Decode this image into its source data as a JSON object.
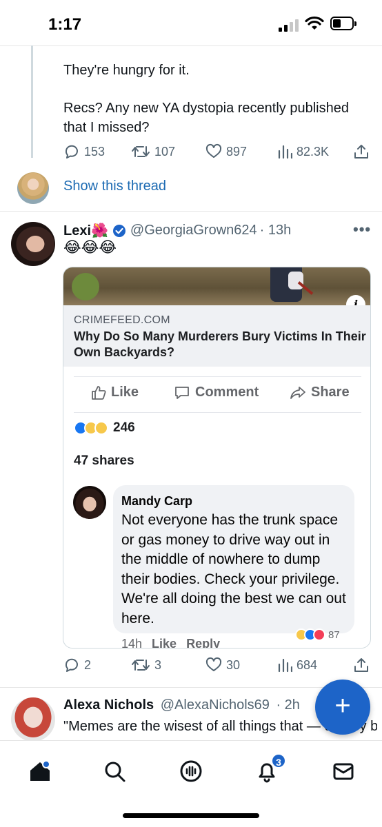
{
  "status_bar": {
    "time": "1:17"
  },
  "thread_tweet": {
    "line1": "They're hungry for it.",
    "line2": "Recs? Any new YA dystopia recently published",
    "line3": "that I missed?",
    "replies": "153",
    "retweets": "107",
    "likes": "897",
    "views": "82.3K",
    "show_thread": "Show this thread"
  },
  "tweet": {
    "name": "Lexi🌺",
    "handle": "@GeorgiaGrown624",
    "time": "· 13h",
    "more": "•••",
    "text": "😂😂😂",
    "replies": "2",
    "retweets": "3",
    "likes": "30",
    "views": "684",
    "embed": {
      "domain": "CRIMEFEED.COM",
      "title": "Why Do So Many Murderers Bury Victims In Their Own Backyards?",
      "info": "i",
      "like_label": "Like",
      "comment_label": "Comment",
      "share_label": "Share",
      "reaction_count": "246",
      "shares": "47 shares",
      "comment": {
        "author": "Mandy Carp",
        "text": "Not everyone has the trunk space or gas money to drive way out in the middle of nowhere to dump their bodies. Check your privilege. We're all doing the best we can out here.",
        "time": "14h",
        "like": "Like",
        "reply": "Reply",
        "reactions": "87"
      }
    }
  },
  "next_tweet": {
    "name": "Alexa Nichols",
    "handle": "@AlexaNichols69",
    "time": "· 2h",
    "text": "\"Memes are the wisest of all things that — or they bring everything to light\""
  },
  "fab": {
    "label": "+"
  },
  "tabbar": {
    "notification_badge": "3"
  },
  "colors": {
    "accent": "#1d64c8",
    "link": "#1d6bb3",
    "muted": "#536471"
  }
}
